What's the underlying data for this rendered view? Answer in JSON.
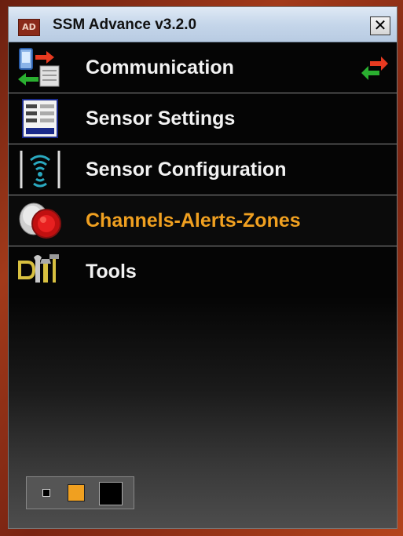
{
  "window": {
    "title": "SSM Advance v3.2.0",
    "app_icon_text": "AD",
    "close_label": "✕"
  },
  "menu": {
    "items": [
      {
        "label": "Communication",
        "icon": "communication-icon",
        "status_icon": "transfer-arrows-icon"
      },
      {
        "label": "Sensor Settings",
        "icon": "settings-sheet-icon"
      },
      {
        "label": "Sensor Configuration",
        "icon": "sensor-signal-icon"
      },
      {
        "label": "Channels-Alerts-Zones",
        "icon": "red-button-icon",
        "active": true
      },
      {
        "label": "Tools",
        "icon": "tools-icon"
      }
    ]
  },
  "theme_selector": {
    "options": [
      "small",
      "orange",
      "black"
    ]
  },
  "colors": {
    "active_label": "#f0a020",
    "label": "#f2f2f2",
    "background": "#050505"
  }
}
